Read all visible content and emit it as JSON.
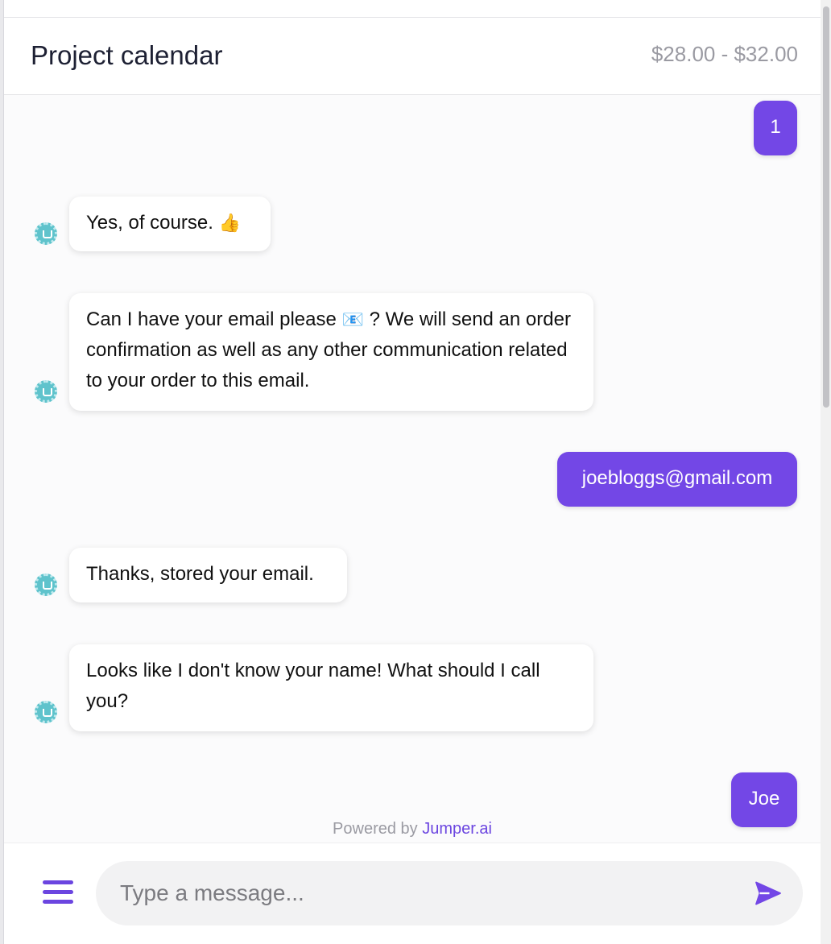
{
  "header": {
    "title": "Project calendar",
    "price_range": "$28.00 - $32.00"
  },
  "messages": [
    {
      "sender": "user",
      "text": "1"
    },
    {
      "sender": "bot",
      "text": "Yes, of course.",
      "emoji": "👍"
    },
    {
      "sender": "bot",
      "text_before": "Can I have your email please",
      "emoji": "📧",
      "text_after": "? We will send an order confirmation as well as any other communication related to your order to this email."
    },
    {
      "sender": "user",
      "text": "joebloggs@gmail.com"
    },
    {
      "sender": "bot",
      "text": "Thanks, stored your email."
    },
    {
      "sender": "bot",
      "text": "Looks like I don't know your name! What should I call you?"
    },
    {
      "sender": "user",
      "text": "Joe"
    }
  ],
  "footer": {
    "powered_prefix": "Powered by",
    "powered_brand": "Jumper.ai",
    "input_placeholder": "Type a message..."
  },
  "icons": {
    "bot_avatar": "bot-avatar-icon",
    "menu": "hamburger-menu-icon",
    "send": "send-icon"
  },
  "colors": {
    "accent": "#7347e6",
    "avatar": "#5fc3cc"
  }
}
